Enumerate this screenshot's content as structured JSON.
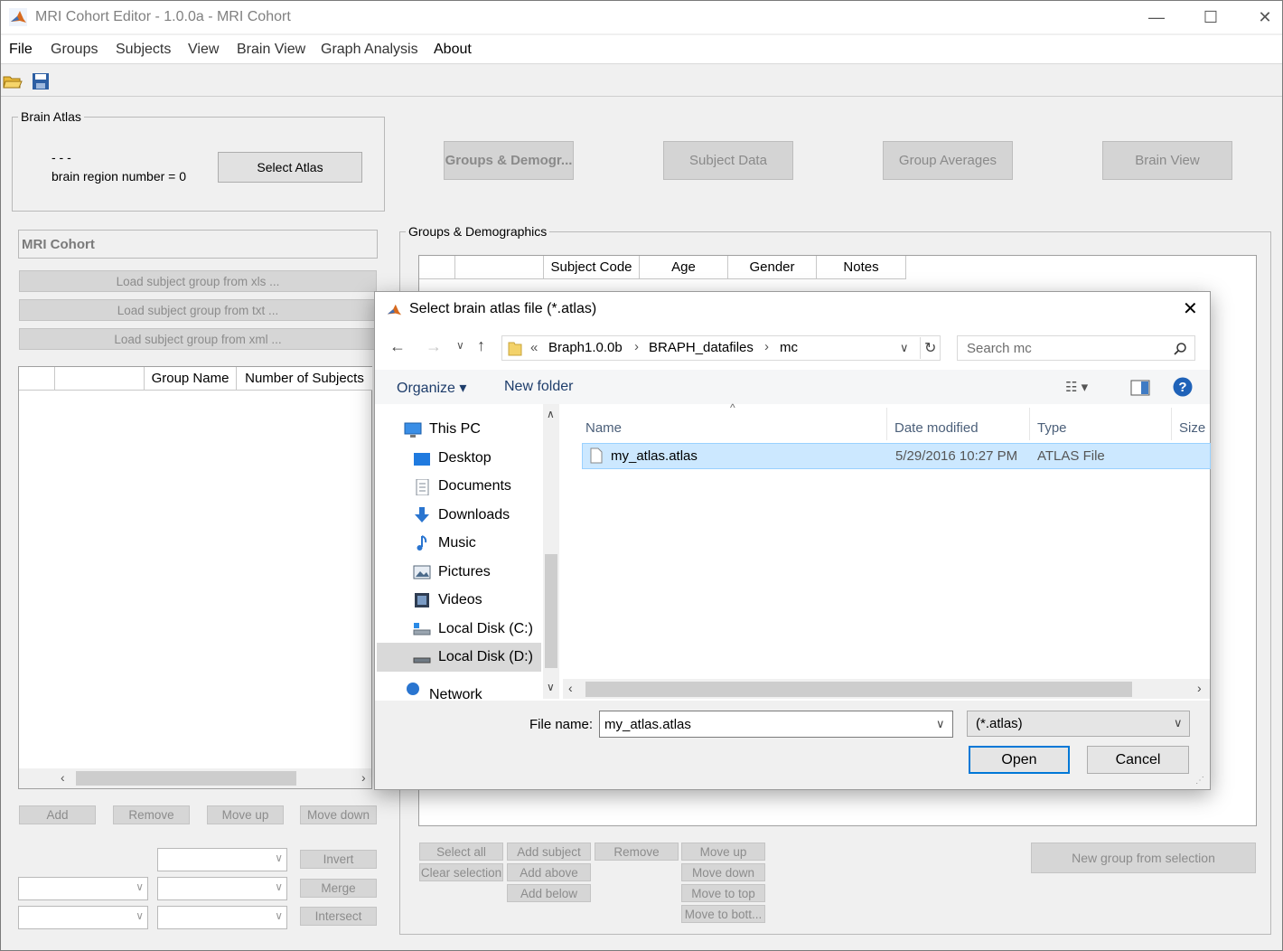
{
  "window": {
    "title": "MRI Cohort Editor - 1.0.0a - MRI Cohort",
    "controls": [
      "—",
      "☐",
      "✕"
    ]
  },
  "menu": [
    "File",
    "Groups",
    "Subjects",
    "View",
    "Brain View",
    "Graph Analysis",
    "About"
  ],
  "brain_atlas": {
    "title": "Brain Atlas",
    "dashes": "- - -",
    "region_count": "brain region number = 0",
    "select_button": "Select Atlas"
  },
  "top_buttons": [
    "Groups & Demogr...",
    "Subject Data",
    "Group Averages",
    "Brain View"
  ],
  "cohort": {
    "name": "MRI Cohort",
    "load_buttons": [
      "Load subject group from xls ...",
      "Load subject group from txt ...",
      "Load subject group from xml ..."
    ],
    "table_headers": [
      "",
      "",
      "Group Name",
      "Number of Subjects"
    ],
    "actions": [
      "Add",
      "Remove",
      "Move up",
      "Move down"
    ],
    "set_ops": [
      "Invert",
      "Merge",
      "Intersect"
    ]
  },
  "groups_demo": {
    "title": "Groups & Demographics",
    "table_headers": [
      "",
      "",
      "Subject Code",
      "Age",
      "Gender",
      "Notes"
    ],
    "buttons_col1": [
      "Select all",
      "Clear selection"
    ],
    "buttons_col2": [
      "Add subject",
      "Add above",
      "Add below"
    ],
    "buttons_col3": [
      "Remove"
    ],
    "buttons_col4": [
      "Move up",
      "Move down",
      "Move to top",
      "Move to bott..."
    ],
    "new_group": "New group from selection"
  },
  "dialog": {
    "title": "Select brain atlas file (*.atlas)",
    "path": [
      "«",
      "Braph1.0.0b",
      "›",
      "BRAPH_datafiles",
      "›",
      "mc"
    ],
    "search_placeholder": "Search mc",
    "organize": "Organize ▾",
    "new_folder": "New folder",
    "nav": [
      "This PC",
      "Desktop",
      "Documents",
      "Downloads",
      "Music",
      "Pictures",
      "Videos",
      "Local Disk (C:)",
      "Local Disk (D:)",
      "Network"
    ],
    "columns": [
      "Name",
      "Date modified",
      "Type",
      "Size"
    ],
    "files": [
      {
        "name": "my_atlas.atlas",
        "date": "5/29/2016 10:27 PM",
        "type": "ATLAS File"
      }
    ],
    "file_name_label": "File name:",
    "file_name_value": "my_atlas.atlas",
    "filter": "(*.atlas)",
    "open": "Open",
    "cancel": "Cancel"
  }
}
